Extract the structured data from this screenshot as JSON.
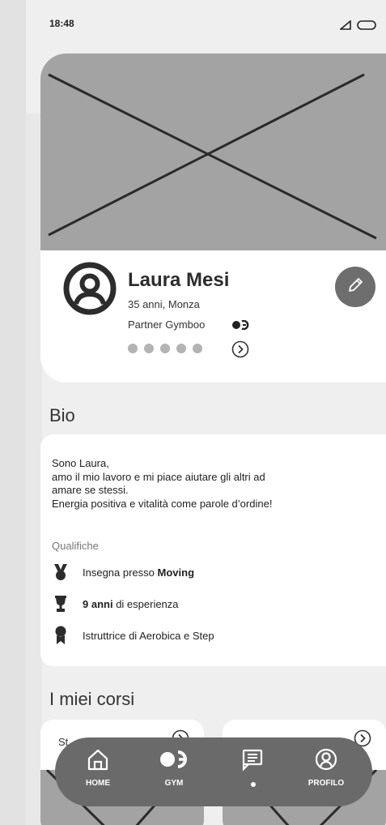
{
  "status_bar": {
    "time": "18:48"
  },
  "profile": {
    "name": "Laura Mesi",
    "subtitle": "35 anni, Monza",
    "partner": "Partner Gymboo",
    "dots_count": 5
  },
  "bio": {
    "title": "Bio",
    "lines": [
      "Sono Laura,",
      "amo il mio lavoro e mi piace aiutare gli altri ad",
      "amare se stessi.",
      "Energia positiva e vitalità come parole d’ordine!"
    ],
    "qualifications_title": "Qualifiche",
    "q1_pre": "Insegna presso ",
    "q1_bold": "Moving",
    "q2_bold": "9 anni",
    "q2_post": " di esperienza",
    "q3": "Istruttrice di Aerobica e Step"
  },
  "courses": {
    "title": "I miei corsi",
    "first_label": "St"
  },
  "nav": {
    "home": "HOME",
    "gym": "GYM",
    "profile": "PROFILO"
  },
  "colors": {
    "nav_bg": "#6a6a6a",
    "placeholder": "#a3a3a3",
    "edit_button": "#6e6e6e"
  }
}
